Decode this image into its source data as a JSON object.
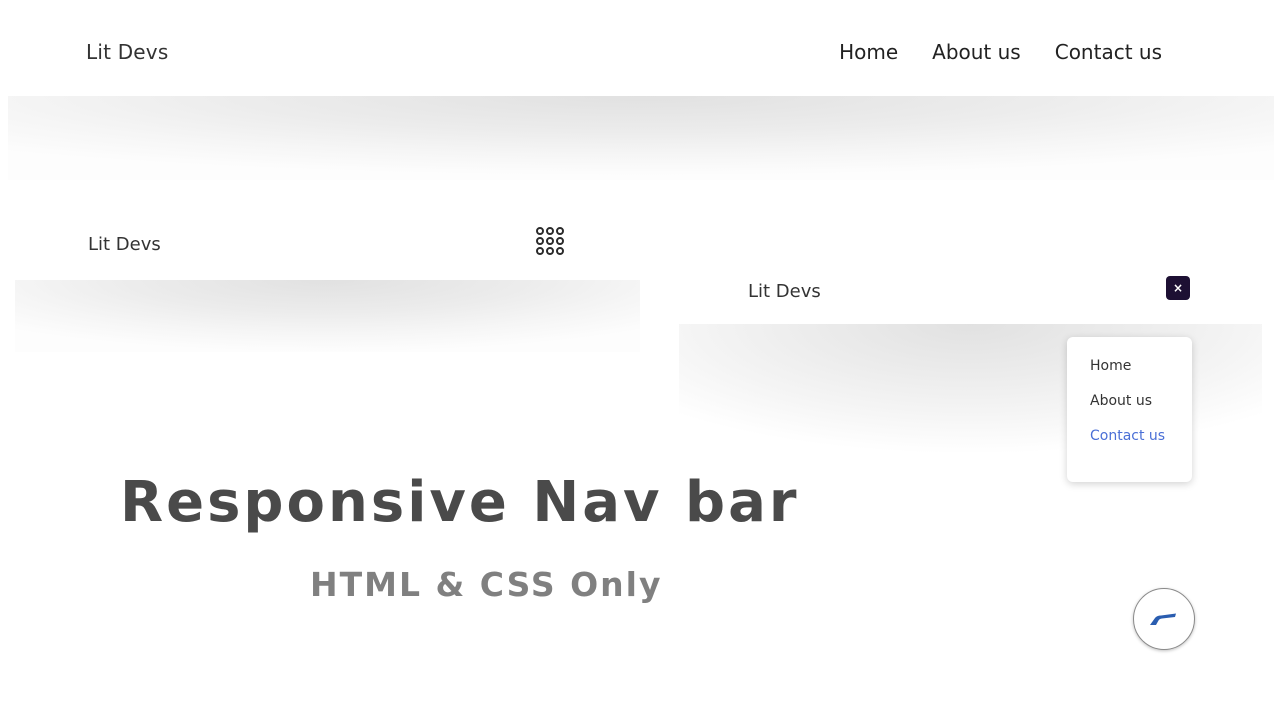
{
  "desktop_nav": {
    "logo": "Lit Devs",
    "links": [
      "Home",
      "About us",
      "Contact us"
    ]
  },
  "mobile_nav": {
    "logo": "Lit Devs",
    "toggle_icon": "grid-menu-icon"
  },
  "open_nav": {
    "logo": "Lit Devs",
    "close_icon": "close-icon",
    "close_glyph": "×",
    "menu": [
      "Home",
      "About us",
      "Contact us"
    ],
    "active_color": "#4a6fd6"
  },
  "headline": {
    "title": "Responsive Nav bar",
    "subtitle": "HTML & CSS Only"
  },
  "fab": {
    "icon": "brand-logo-icon",
    "color": "#2a5db0"
  }
}
